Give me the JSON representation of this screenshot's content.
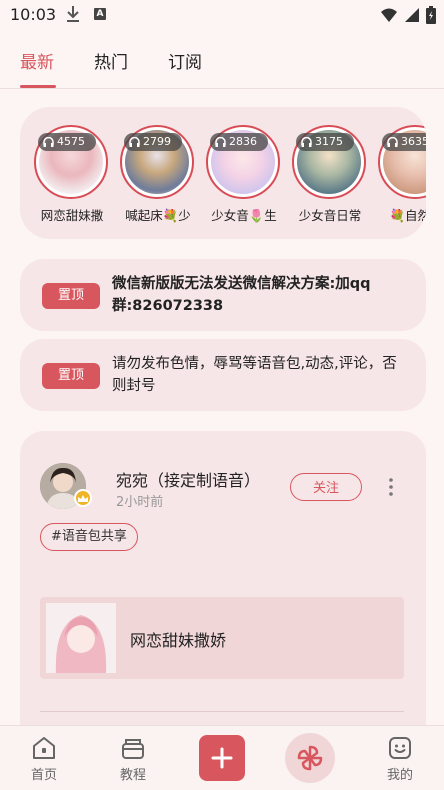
{
  "status_bar": {
    "time": "10:03"
  },
  "tabs": [
    {
      "label": "最新"
    },
    {
      "label": "热门"
    },
    {
      "label": "订阅"
    }
  ],
  "stories": [
    {
      "count": "4575",
      "name": "网恋甜妹撒"
    },
    {
      "count": "2799",
      "name": "喊起床💐少"
    },
    {
      "count": "2836",
      "name": "少女音🌷生"
    },
    {
      "count": "3175",
      "name": "少女音日常"
    },
    {
      "count": "3635",
      "name": "💐自然少"
    }
  ],
  "notices": [
    {
      "pin_label": "置顶",
      "text": "微信新版版无法发送微信解决方案:加qq群:826072338"
    },
    {
      "pin_label": "置顶",
      "text": "请勿发布色情，辱骂等语音包,动态,评论，否则封号"
    }
  ],
  "post": {
    "author": "宛宛（接定制语音）",
    "time": "2小时前",
    "follow_label": "关注",
    "tag": "#语音包共享",
    "voice_pack_name": "网恋甜妹撒娇"
  },
  "bottom_nav": {
    "home": "首页",
    "tutorial": "教程",
    "mine": "我的"
  },
  "colors": {
    "accent": "#d8575e",
    "card": "#f7e6e7",
    "background": "#fdf4f4"
  }
}
